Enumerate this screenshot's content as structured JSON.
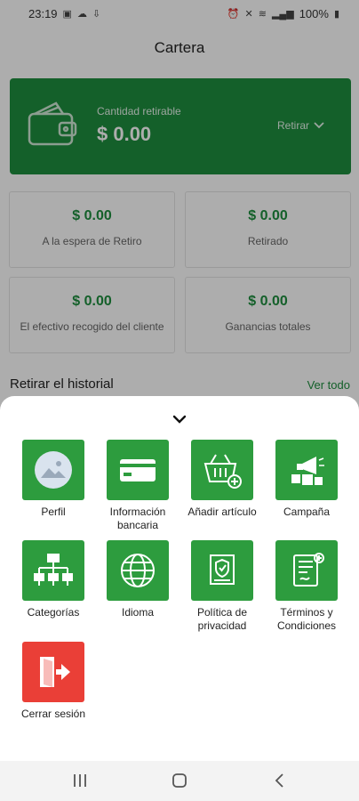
{
  "status_bar": {
    "time": "23:19",
    "battery": "100%"
  },
  "page": {
    "title": "Cartera"
  },
  "wallet": {
    "label": "Cantidad retirable",
    "amount": "$ 0.00",
    "action": "Retirar"
  },
  "stats": [
    {
      "amount": "$ 0.00",
      "label": "A la espera de Retiro"
    },
    {
      "amount": "$ 0.00",
      "label": "Retirado"
    },
    {
      "amount": "$ 0.00",
      "label": "El efectivo recogido del cliente"
    },
    {
      "amount": "$ 0.00",
      "label": "Ganancias totales"
    }
  ],
  "history": {
    "title": "Retirar el historial",
    "link": "Ver todo"
  },
  "menu": {
    "items": [
      {
        "label": "Perfil",
        "icon": "profile-image-icon"
      },
      {
        "label": "Información bancaria",
        "icon": "credit-card-icon"
      },
      {
        "label": "Añadir artículo",
        "icon": "basket-add-icon"
      },
      {
        "label": "Campaña",
        "icon": "megaphone-icon"
      },
      {
        "label": "Categorías",
        "icon": "hierarchy-icon"
      },
      {
        "label": "Idioma",
        "icon": "globe-icon"
      },
      {
        "label": "Política de privacidad",
        "icon": "shield-document-icon"
      },
      {
        "label": "Términos y Condiciones",
        "icon": "contract-icon"
      },
      {
        "label": "Cerrar sesión",
        "icon": "logout-icon"
      }
    ]
  },
  "colors": {
    "brand_green": "#1e8e3e",
    "tile_green": "#2d9c3e",
    "logout_red": "#ea3f37"
  }
}
